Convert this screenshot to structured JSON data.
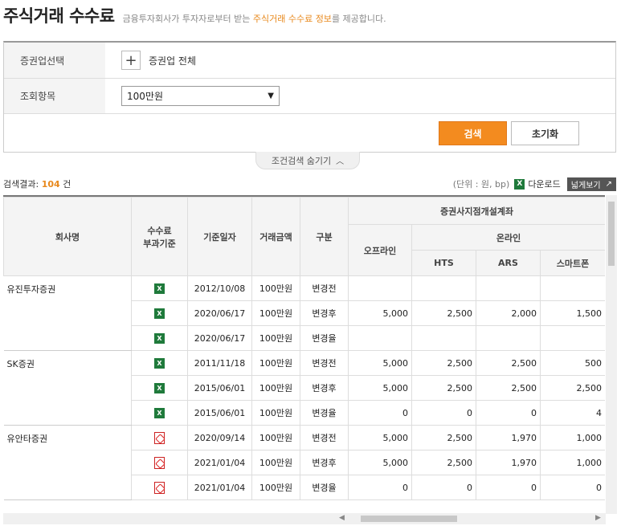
{
  "header": {
    "title": "주식거래 수수료",
    "desc_prefix": "금융투자회사가 투자자로부터 받는 ",
    "desc_highlight": "주식거래 수수료 정보",
    "desc_suffix": "를 제공합니다."
  },
  "filter": {
    "company_label": "증권업선택",
    "company_value": "증권업 전체",
    "item_label": "조회항목",
    "item_select": "100만원",
    "search_btn": "검색",
    "reset_btn": "초기화",
    "toggle_label": "조건검색 숨기기"
  },
  "result": {
    "label": "검색결과: ",
    "count": "104",
    "unit": " 건",
    "unit_note": "(단위 : 원, bp)",
    "download": "다운로드",
    "wide_view": "넓게보기"
  },
  "table": {
    "headers": {
      "company": "회사명",
      "basis": "수수료\n부과기준",
      "date": "기준일자",
      "amount": "거래금액",
      "type": "구분",
      "account_group": "증권사지점개설계좌",
      "offline": "오프라인",
      "online": "온라인",
      "hts": "HTS",
      "ars": "ARS",
      "smartphone": "스마트폰"
    },
    "groups": [
      {
        "company": "유진투자증권",
        "rows": [
          {
            "icon": "excel",
            "date": "2012/10/08",
            "amount": "100만원",
            "type": "변경전",
            "offline": "",
            "hts": "",
            "ars": "",
            "smart": ""
          },
          {
            "icon": "excel",
            "date": "2020/06/17",
            "amount": "100만원",
            "type": "변경후",
            "offline": "5,000",
            "hts": "2,500",
            "ars": "2,000",
            "smart": "1,500"
          },
          {
            "icon": "excel",
            "date": "2020/06/17",
            "amount": "100만원",
            "type": "변경율",
            "offline": "",
            "hts": "",
            "ars": "",
            "smart": ""
          }
        ]
      },
      {
        "company": "SK증권",
        "rows": [
          {
            "icon": "excel",
            "date": "2011/11/18",
            "amount": "100만원",
            "type": "변경전",
            "offline": "5,000",
            "hts": "2,500",
            "ars": "2,500",
            "smart": "500"
          },
          {
            "icon": "excel",
            "date": "2015/06/01",
            "amount": "100만원",
            "type": "변경후",
            "offline": "5,000",
            "hts": "2,500",
            "ars": "2,500",
            "smart": "2,500"
          },
          {
            "icon": "excel",
            "date": "2015/06/01",
            "amount": "100만원",
            "type": "변경율",
            "offline": "0",
            "hts": "0",
            "ars": "0",
            "smart": "4"
          }
        ]
      },
      {
        "company": "유안타증권",
        "rows": [
          {
            "icon": "pdf",
            "date": "2020/09/14",
            "amount": "100만원",
            "type": "변경전",
            "offline": "5,000",
            "hts": "2,500",
            "ars": "1,970",
            "smart": "1,000"
          },
          {
            "icon": "pdf",
            "date": "2021/01/04",
            "amount": "100만원",
            "type": "변경후",
            "offline": "5,000",
            "hts": "2,500",
            "ars": "1,970",
            "smart": "1,000"
          },
          {
            "icon": "pdf",
            "date": "2021/01/04",
            "amount": "100만원",
            "type": "변경율",
            "offline": "0",
            "hts": "0",
            "ars": "0",
            "smart": "0"
          }
        ]
      }
    ]
  }
}
